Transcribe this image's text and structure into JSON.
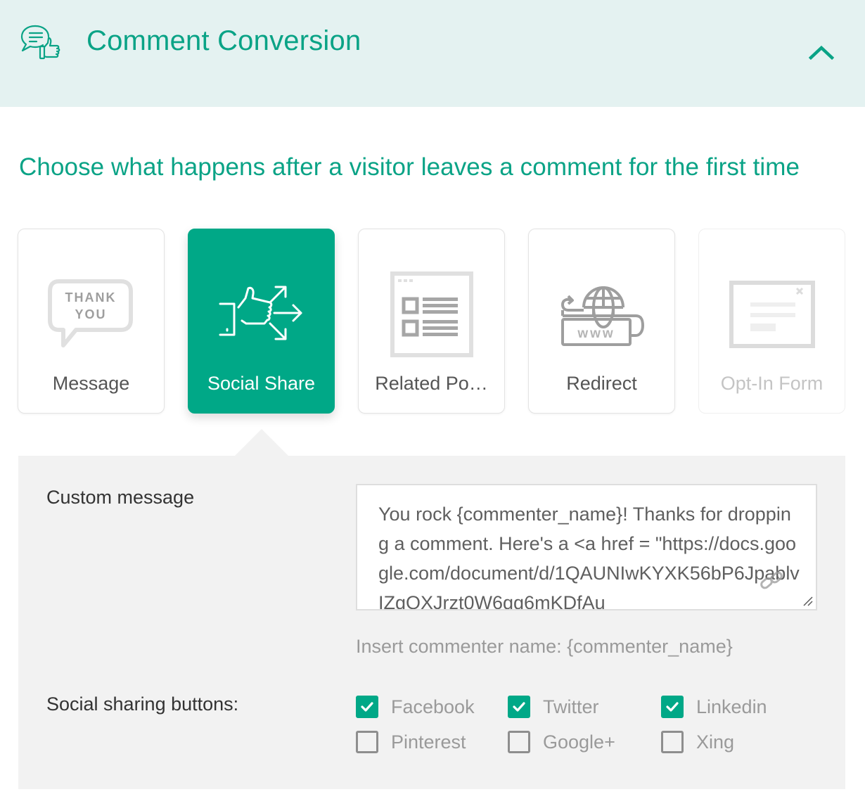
{
  "header": {
    "title": "Comment Conversion",
    "icon": "comment-thumbs-up-icon",
    "collapse_icon": "chevron-up-icon",
    "accent_color": "#0aa386",
    "background_color": "#e4f2f1"
  },
  "subtitle": "Choose what happens after a visitor leaves a comment for the first time",
  "options": [
    {
      "label": "Message",
      "icon": "thank-you-bubble-icon",
      "icon_text_1": "THANK",
      "icon_text_2": "YOU",
      "state": "default"
    },
    {
      "label": "Social Share",
      "icon": "thumbs-up-share-icon",
      "state": "selected"
    },
    {
      "label": "Related Po…",
      "icon": "related-posts-icon",
      "state": "default"
    },
    {
      "label": "Redirect",
      "icon": "globe-www-redirect-icon",
      "icon_text": "www",
      "state": "default"
    },
    {
      "label": "Opt-In Form",
      "icon": "optin-form-window-icon",
      "state": "disabled"
    }
  ],
  "panel": {
    "custom_message_label": "Custom message",
    "custom_message_value": "You rock {commenter_name}! Thanks for dropping a comment. Here's a <a href = \"https://docs.google.com/document/d/1QAUNIwKYXK56bP6JpablvIZqOXJrzt0W6qq6mKDfAu",
    "hint": "Insert commenter name: {commenter_name}",
    "social_label": "Social sharing buttons:",
    "social_buttons": [
      {
        "label": "Facebook",
        "checked": true
      },
      {
        "label": "Twitter",
        "checked": true
      },
      {
        "label": "Linkedin",
        "checked": true
      },
      {
        "label": "Pinterest",
        "checked": false
      },
      {
        "label": "Google+",
        "checked": false
      },
      {
        "label": "Xing",
        "checked": false
      }
    ]
  },
  "colors": {
    "selected_card": "#00a887",
    "checkbox_checked": "#00a887",
    "panel_background": "#f2f2f2"
  }
}
